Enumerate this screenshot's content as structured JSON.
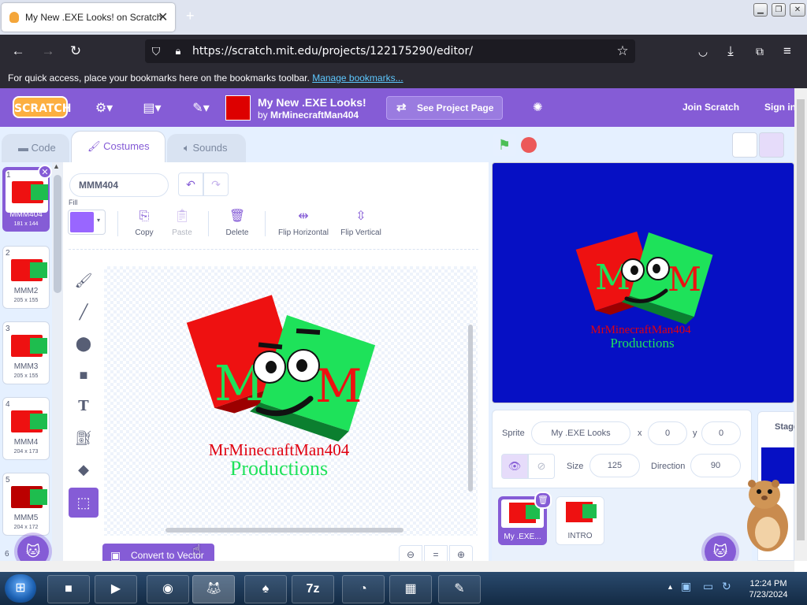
{
  "browser": {
    "tab_title": "My New .EXE Looks! on Scratch",
    "url": "https://scratch.mit.edu/projects/122175290/editor/",
    "bookmarks_text": "For quick access, place your bookmarks here on the bookmarks toolbar.",
    "bookmarks_link": "Manage bookmarks..."
  },
  "scratch_header": {
    "logo": "SCRATCH",
    "project_title": "My New .EXE Looks!",
    "by_label": "by",
    "author": "MrMinecraftMan404",
    "see_project_page": "See Project Page",
    "join": "Join Scratch",
    "sign_in": "Sign in"
  },
  "editor_tabs": [
    {
      "label": "Code"
    },
    {
      "label": "Costumes"
    },
    {
      "label": "Sounds"
    }
  ],
  "costumes": [
    {
      "number": "1",
      "name": "MMM404",
      "size": "181 x 144"
    },
    {
      "number": "2",
      "name": "MMM2",
      "size": "205 x 155"
    },
    {
      "number": "3",
      "name": "MMM3",
      "size": "205 x 155"
    },
    {
      "number": "4",
      "name": "MMM4",
      "size": "204 x 173"
    },
    {
      "number": "5",
      "name": "MMM5",
      "size": "204 x 172"
    },
    {
      "number": "6",
      "name": "",
      "size": ""
    }
  ],
  "paint_editor": {
    "costume_name": "MMM404",
    "fill_label": "Fill",
    "fill_color": "#9966ff",
    "tools": {
      "copy": "Copy",
      "paste": "Paste",
      "delete": "Delete",
      "flip_horizontal": "Flip Horizontal",
      "flip_vertical": "Flip Vertical"
    },
    "convert_button": "Convert to Vector",
    "zoom_reset": "="
  },
  "artwork": {
    "letter_left": "M",
    "letter_right": "M",
    "line1": "MrMinecraftMan404",
    "line2": "Productions"
  },
  "sprite_info": {
    "sprite_label": "Sprite",
    "sprite_name": "My .EXE Looks",
    "x_label": "x",
    "x_value": "0",
    "y_label": "y",
    "y_value": "0",
    "size_label": "Size",
    "size_value": "125",
    "direction_label": "Direction",
    "direction_value": "90"
  },
  "sprites": [
    {
      "name": "My .EXE..."
    },
    {
      "name": "INTRO"
    }
  ],
  "stage_label": "Stage",
  "taskbar": {
    "time": "12:24 PM",
    "date": "7/23/2024"
  },
  "colors": {
    "scratch_purple": "#855cd6",
    "stage_bg": "#0610c4",
    "logo_red": "#e11a1a",
    "logo_green": "#1ebd4e"
  }
}
